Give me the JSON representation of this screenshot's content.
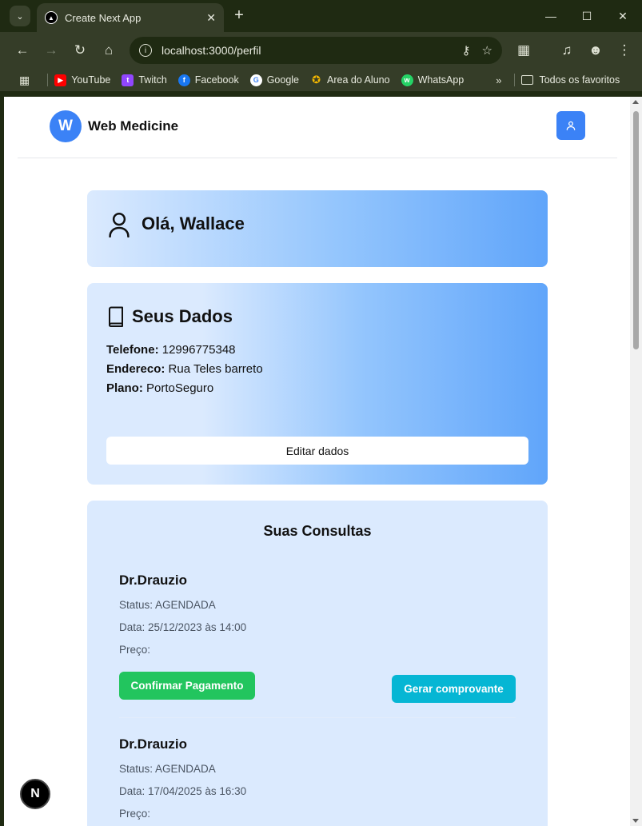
{
  "browser": {
    "tab_title": "Create Next App",
    "url": "localhost:3000/perfil",
    "bookmarks": [
      {
        "label": "YouTube",
        "color": "#ff0000"
      },
      {
        "label": "Twitch",
        "color": "#9146ff"
      },
      {
        "label": "Facebook",
        "color": "#1877f2"
      },
      {
        "label": "Google",
        "color": "#ffffff"
      },
      {
        "label": "Area do Aluno",
        "color": "#f5b800"
      },
      {
        "label": "WhatsApp",
        "color": "#25d366"
      }
    ],
    "all_bookmarks_label": "Todos os favoritos"
  },
  "header": {
    "logo_letter": "W",
    "brand_name": "Web Medicine"
  },
  "greeting": {
    "text": "Olá, Wallace"
  },
  "profile_data": {
    "title": "Seus Dados",
    "fields": [
      {
        "label": "Telefone:",
        "value": "12996775348"
      },
      {
        "label": "Endereco:",
        "value": "Rua Teles barreto"
      },
      {
        "label": "Plano:",
        "value": "PortoSeguro"
      }
    ],
    "edit_label": "Editar dados"
  },
  "consultations": {
    "title": "Suas Consultas",
    "items": [
      {
        "doctor": "Dr.Drauzio",
        "status": "Status: AGENDADA",
        "date": "Data: 25/12/2023 às 14:00",
        "price": "Preço:",
        "pay_label": "Confirmar Pagamento",
        "receipt_label": "Gerar comprovante"
      },
      {
        "doctor": "Dr.Drauzio",
        "status": "Status: AGENDADA",
        "date": "Data: 17/04/2025 às 16:30",
        "price": "Preço:"
      }
    ]
  },
  "next_badge": "N",
  "colors": {
    "primary": "#3b82f6",
    "success": "#22c55e",
    "info": "#06b6d4",
    "card_light": "#dbeafe"
  }
}
